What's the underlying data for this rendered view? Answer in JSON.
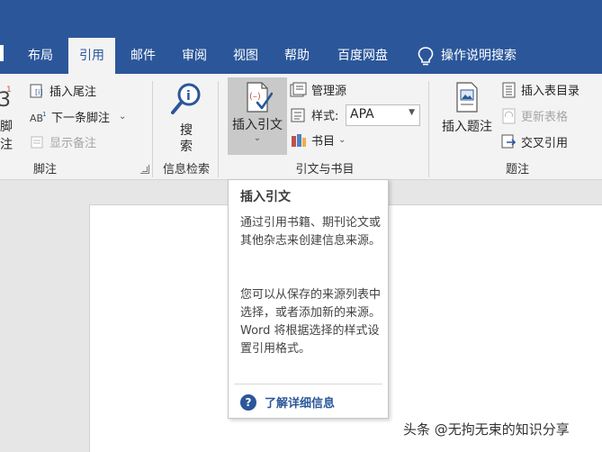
{
  "tabs": [
    {
      "label": "布局"
    },
    {
      "label": "引用",
      "active": true
    },
    {
      "label": "邮件"
    },
    {
      "label": "审阅"
    },
    {
      "label": "视图"
    },
    {
      "label": "帮助"
    },
    {
      "label": "百度网盘"
    }
  ],
  "tell_me": {
    "label": "操作说明搜索",
    "icon": "lightbulb-icon"
  },
  "ribbon": {
    "footnotes": {
      "group_label": "脚注",
      "big_label": "脚注",
      "insert_endnote": "插入尾注",
      "next_footnote": "下一条脚注",
      "show_notes": "显示备注"
    },
    "research": {
      "group_label": "信息检索",
      "search_line1": "搜",
      "search_line2": "索"
    },
    "citations": {
      "group_label": "引文与书目",
      "insert_citation": "插入引文",
      "manage_sources": "管理源",
      "style_label": "样式:",
      "style_value": "APA",
      "bibliography": "书目"
    },
    "captions": {
      "group_label": "题注",
      "insert_caption": "插入题注",
      "insert_table_of_figures": "插入表目录",
      "update_table": "更新表格",
      "cross_reference": "交叉引用"
    }
  },
  "tooltip": {
    "title": "插入引文",
    "para1": "通过引用书籍、期刊论文或其他杂志来创建信息来源。",
    "para2": "您可以从保存的来源列表中选择，或者添加新的来源。Word 将根据选择的样式设置引用格式。",
    "help_link": "了解详细信息"
  },
  "watermark": "头条 @无拘无束的知识分享",
  "colors": {
    "accent": "#2b579a",
    "citation_red": "#c0504d"
  }
}
